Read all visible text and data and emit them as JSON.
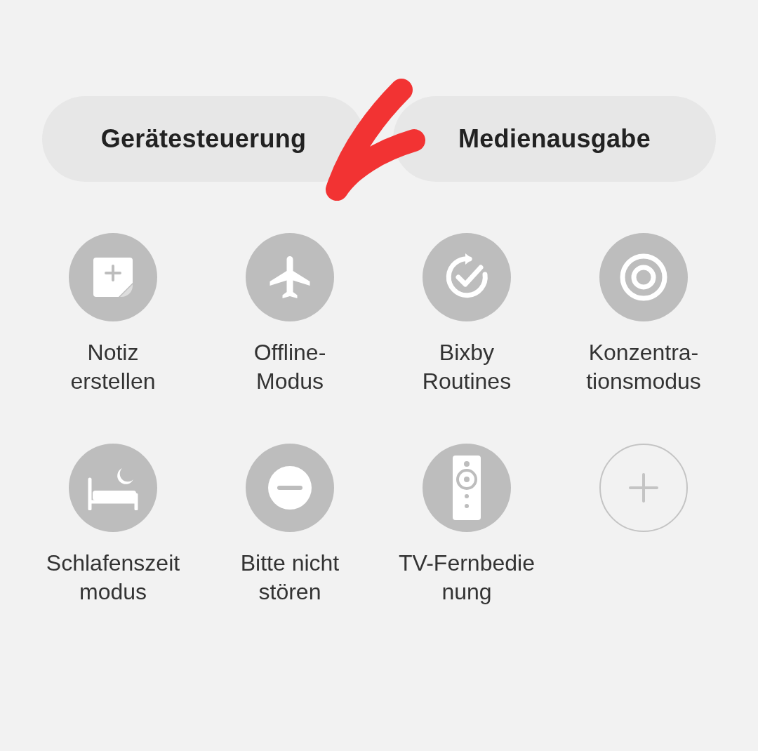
{
  "tabs": [
    {
      "label": "Gerätesteuerung"
    },
    {
      "label": "Medienausgabe"
    }
  ],
  "tiles": [
    {
      "kind": "toggle",
      "label": "Notiz\nerstellen",
      "on": false
    },
    {
      "kind": "toggle",
      "label": "Offline-\nModus",
      "on": false
    },
    {
      "kind": "toggle",
      "label": "Bixby\nRoutines",
      "on": false
    },
    {
      "kind": "toggle",
      "label": "Konzentra-\ntionsmodus",
      "on": false
    },
    {
      "kind": "toggle",
      "label": "Schlafenszeit\nmodus",
      "on": false
    },
    {
      "kind": "toggle",
      "label": "Bitte nicht\nstören",
      "on": false
    },
    {
      "kind": "toggle",
      "label": "TV-Fernbedie\nnung",
      "on": false
    },
    {
      "kind": "add"
    }
  ]
}
